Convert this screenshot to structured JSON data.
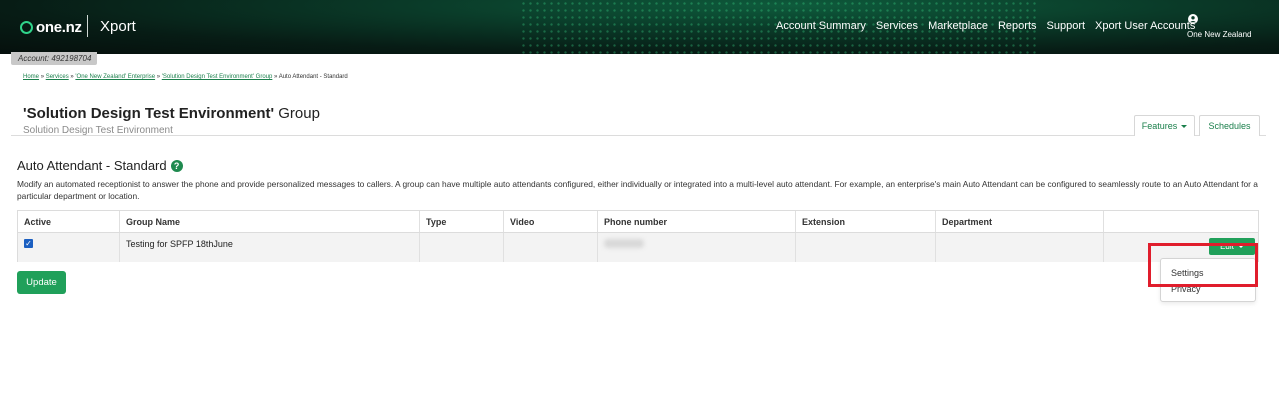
{
  "header": {
    "logo_text": "one.nz",
    "app_name": "Xport",
    "nav": [
      "Account Summary",
      "Services",
      "Marketplace",
      "Reports",
      "Support",
      "Xport User Accounts"
    ],
    "user_label": "One New Zealand"
  },
  "account": {
    "label": "Account: 492198704"
  },
  "breadcrumb": {
    "items": [
      "Home",
      "Services",
      "'One New Zealand' Enterprise",
      "'Solution Design Test Environment' Group"
    ],
    "separator": "»",
    "current": "Auto Attendant - Standard"
  },
  "page": {
    "title_bold": "'Solution Design Test Environment'",
    "title_rest": "Group",
    "subtitle": "Solution Design Test Environment"
  },
  "tabs": {
    "features": "Features",
    "schedules": "Schedules"
  },
  "section": {
    "title": "Auto Attendant - Standard",
    "help": "?",
    "description": "Modify an automated receptionist to answer the phone and provide personalized messages to callers. A group can have multiple auto attendants configured, either individually or integrated into a multi-level auto attendant. For example, an enterprise's main Auto Attendant can be configured to seamlessly route to an Auto Attendant for a particular department or location."
  },
  "table": {
    "headers": [
      "Active",
      "Group Name",
      "Type",
      "Video",
      "Phone number",
      "Extension",
      "Department",
      ""
    ],
    "rows": [
      {
        "active": "✓",
        "group_name": "Testing for SPFP 18thJune",
        "type": "",
        "video": "",
        "phone": "",
        "extension": "",
        "department": ""
      }
    ]
  },
  "actions": {
    "edit_label": "Edit",
    "update_label": "Update"
  },
  "dropdown": {
    "items": [
      "Settings",
      "Privacy"
    ]
  },
  "colors": {
    "accent": "#20a05a",
    "highlight": "#e01d2c",
    "header_bg": "#0a3a28"
  }
}
